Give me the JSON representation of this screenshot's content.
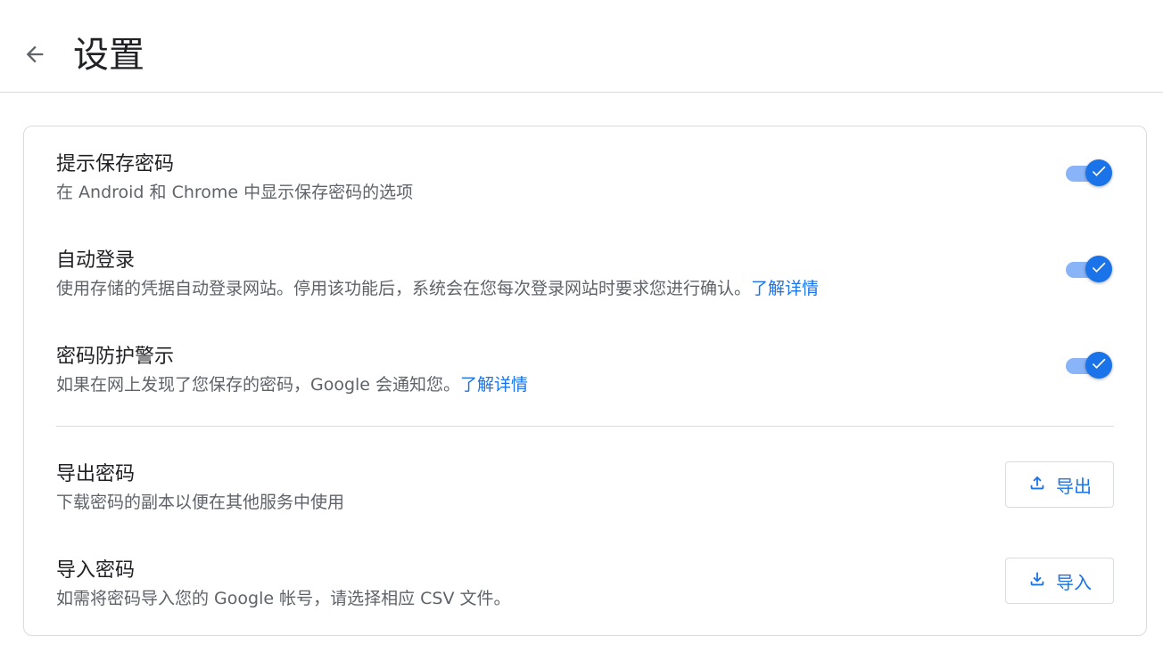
{
  "header": {
    "title": "设置",
    "back_icon": "arrow-left-icon"
  },
  "settings": {
    "offer_save": {
      "title": "提示保存密码",
      "description": "在 Android 和 Chrome 中显示保存密码的选项",
      "enabled": true
    },
    "auto_signin": {
      "title": "自动登录",
      "description": "使用存储的凭据自动登录网站。停用该功能后，系统会在您每次登录网站时要求您进行确认。",
      "link_label": "了解详情",
      "enabled": true
    },
    "leak_alert": {
      "title": "密码防护警示",
      "description": "如果在网上发现了您保存的密码，Google 会通知您。",
      "link_label": "了解详情",
      "enabled": true
    },
    "export": {
      "title": "导出密码",
      "description": "下载密码的副本以便在其他服务中使用",
      "button_label": "导出",
      "button_icon": "upload-icon"
    },
    "import": {
      "title": "导入密码",
      "description": "如需将密码导入您的 Google 帐号，请选择相应 CSV 文件。",
      "button_label": "导入",
      "button_icon": "download-icon"
    }
  },
  "colors": {
    "accent": "#1a73e8",
    "toggle_track": "#8ab4f8",
    "secondary_text": "#5f6368",
    "border": "#dadce0"
  }
}
